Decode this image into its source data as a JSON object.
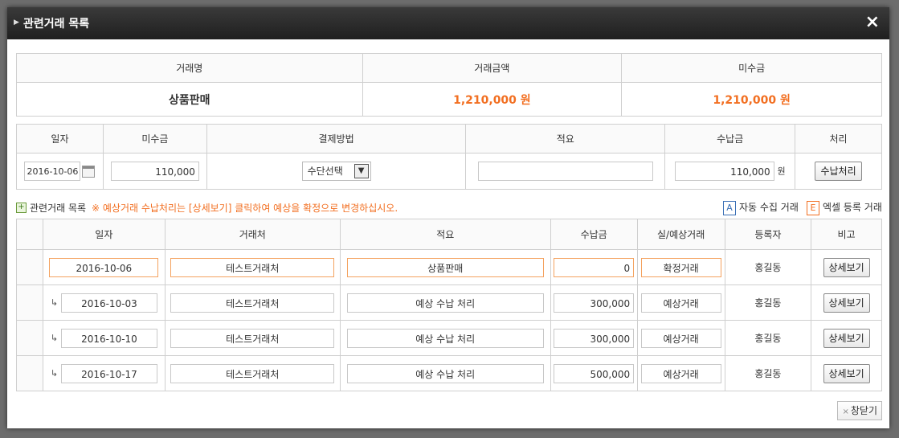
{
  "modal": {
    "title": "관련거래 목록",
    "close_icon": "×"
  },
  "summary": {
    "headers": [
      "거래명",
      "거래금액",
      "미수금"
    ],
    "name": "상품판매",
    "amount": "1,210,000 원",
    "unpaid": "1,210,000 원"
  },
  "payment": {
    "headers": [
      "일자",
      "미수금",
      "결제방법",
      "적요",
      "수납금",
      "처리"
    ],
    "date": "2016-10-06",
    "unpaid": "110,000",
    "method": "수단선택",
    "memo": "",
    "received": "110,000",
    "unit": "원",
    "process_label": "수납처리"
  },
  "list_header": {
    "label": "관련거래 목록",
    "note": "※ 예상거래 수납처리는 [상세보기] 클릭하여 예상을 확정으로 변경하십시오.",
    "auto_badge": "A",
    "auto_label": "자동 수집 거래",
    "excel_badge": "E",
    "excel_label": "엑셀 등록 거래"
  },
  "list": {
    "headers": [
      "일자",
      "거래처",
      "적요",
      "수납금",
      "실/예상거래",
      "등록자",
      "비고"
    ],
    "sub_marker": "↳",
    "rows": [
      {
        "date": "2016-10-06",
        "client": "테스트거래처",
        "memo": "상품판매",
        "amount": "0",
        "type": "확정거래",
        "registrant": "홍길동",
        "action": "상세보기"
      },
      {
        "date": "2016-10-03",
        "client": "테스트거래처",
        "memo": "예상 수납 처리",
        "amount": "300,000",
        "type": "예상거래",
        "registrant": "홍길동",
        "action": "상세보기"
      },
      {
        "date": "2016-10-10",
        "client": "테스트거래처",
        "memo": "예상 수납 처리",
        "amount": "300,000",
        "type": "예상거래",
        "registrant": "홍길동",
        "action": "상세보기"
      },
      {
        "date": "2016-10-17",
        "client": "테스트거래처",
        "memo": "예상 수납 처리",
        "amount": "500,000",
        "type": "예상거래",
        "registrant": "홍길동",
        "action": "상세보기"
      }
    ]
  },
  "footer": {
    "close_label": "창닫기",
    "close_x": "×"
  },
  "colors": {
    "accent": "#f26f21",
    "titlebar": "#2a2a2a",
    "auto_badge": "#3a6fb5"
  }
}
